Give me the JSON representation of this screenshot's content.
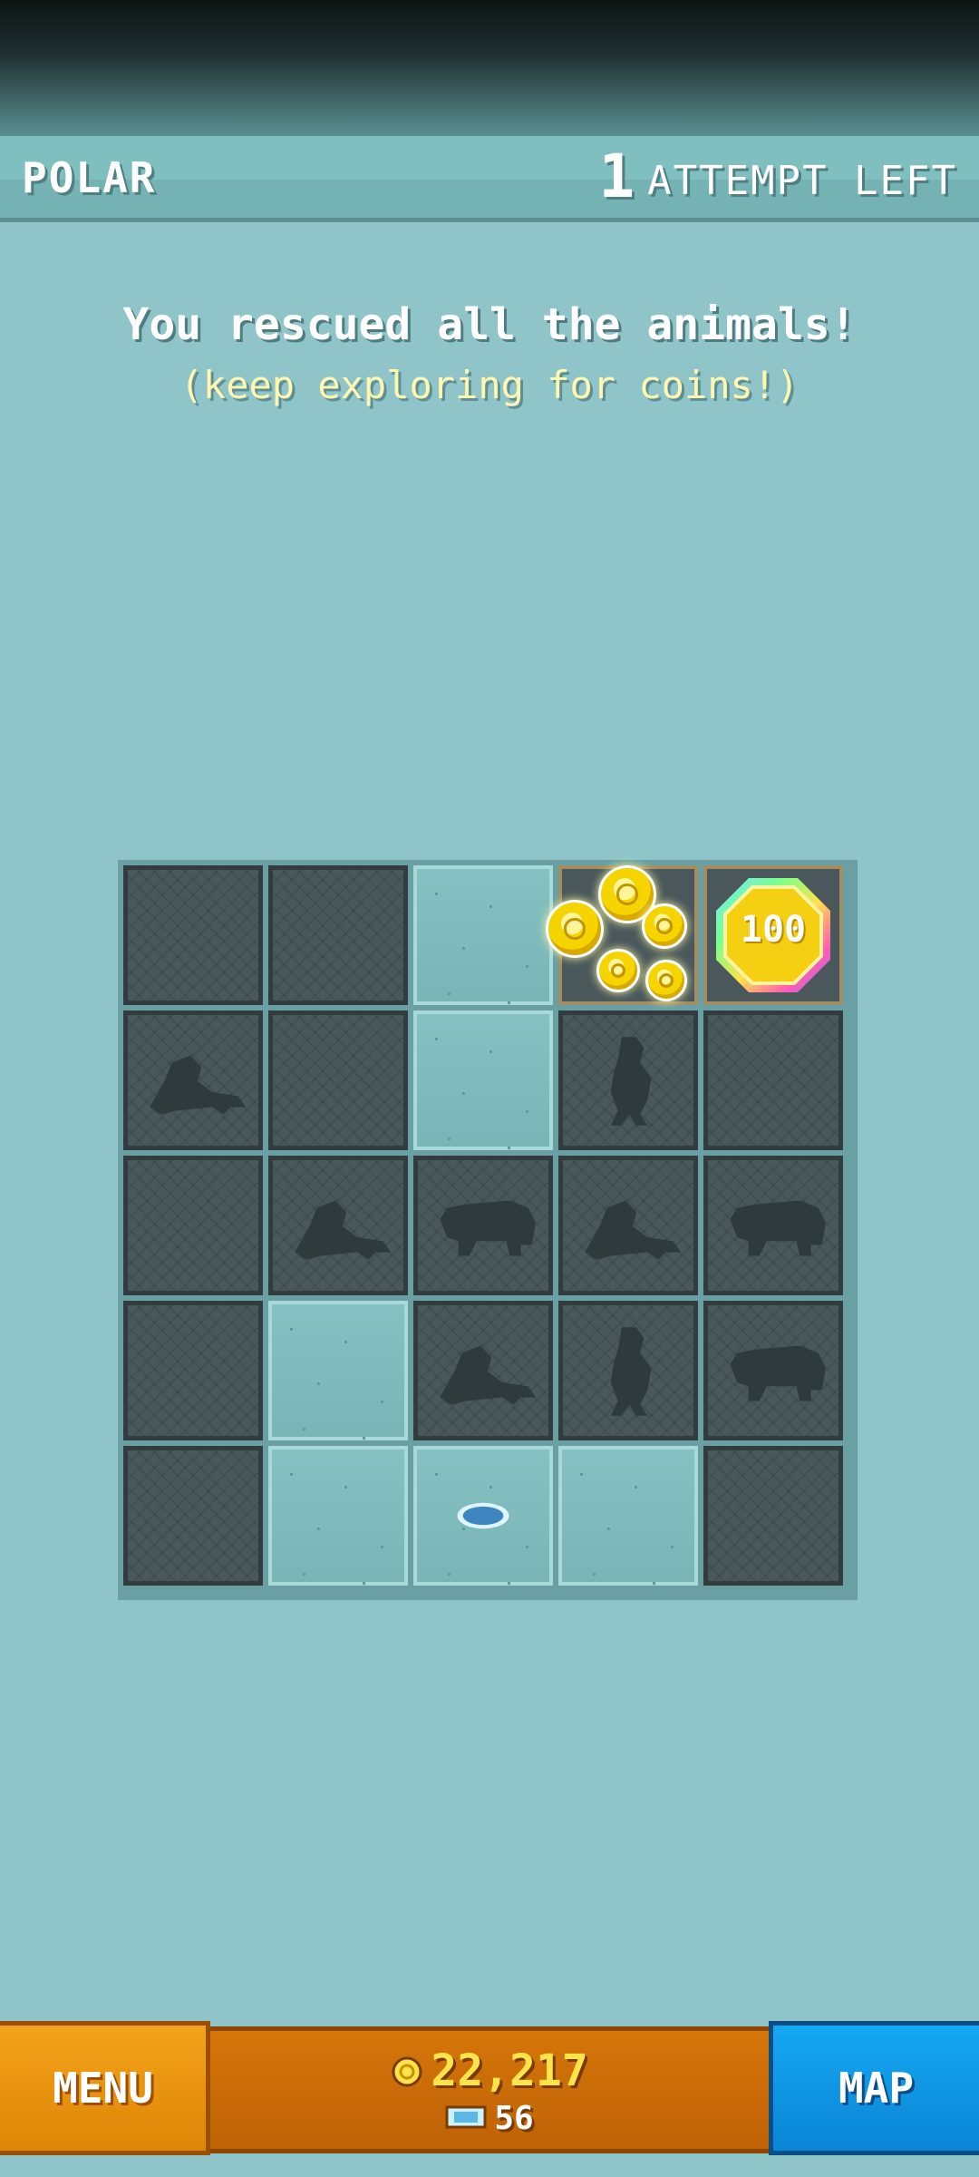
{
  "header": {
    "level_name": "POLAR",
    "attempts_count": "1",
    "attempts_label": "ATTEMPT LEFT"
  },
  "message": {
    "title": "You rescued all the animals!",
    "subtitle": "(keep exploring for coins!)"
  },
  "grid": {
    "rows": 5,
    "cols": 5,
    "cells": [
      [
        "hidden",
        "hidden",
        "open",
        "coins-cluster",
        "coin-100"
      ],
      [
        "walrus",
        "hidden",
        "open",
        "penguin",
        "hidden"
      ],
      [
        "hidden",
        "walrus",
        "polar-bear",
        "walrus",
        "polar-bear"
      ],
      [
        "hidden",
        "open",
        "walrus",
        "penguin",
        "polar-bear"
      ],
      [
        "hidden",
        "open",
        "ice-hole",
        "open",
        "hidden"
      ]
    ],
    "big_coin_value": "100"
  },
  "footer": {
    "menu_label": "MENU",
    "coins": "22,217",
    "gems": "56",
    "map_label": "MAP"
  },
  "colors": {
    "background": "#8fc5c9",
    "menu": "#f3a31a",
    "map": "#15a8f2",
    "coin": "#ffe34a"
  }
}
